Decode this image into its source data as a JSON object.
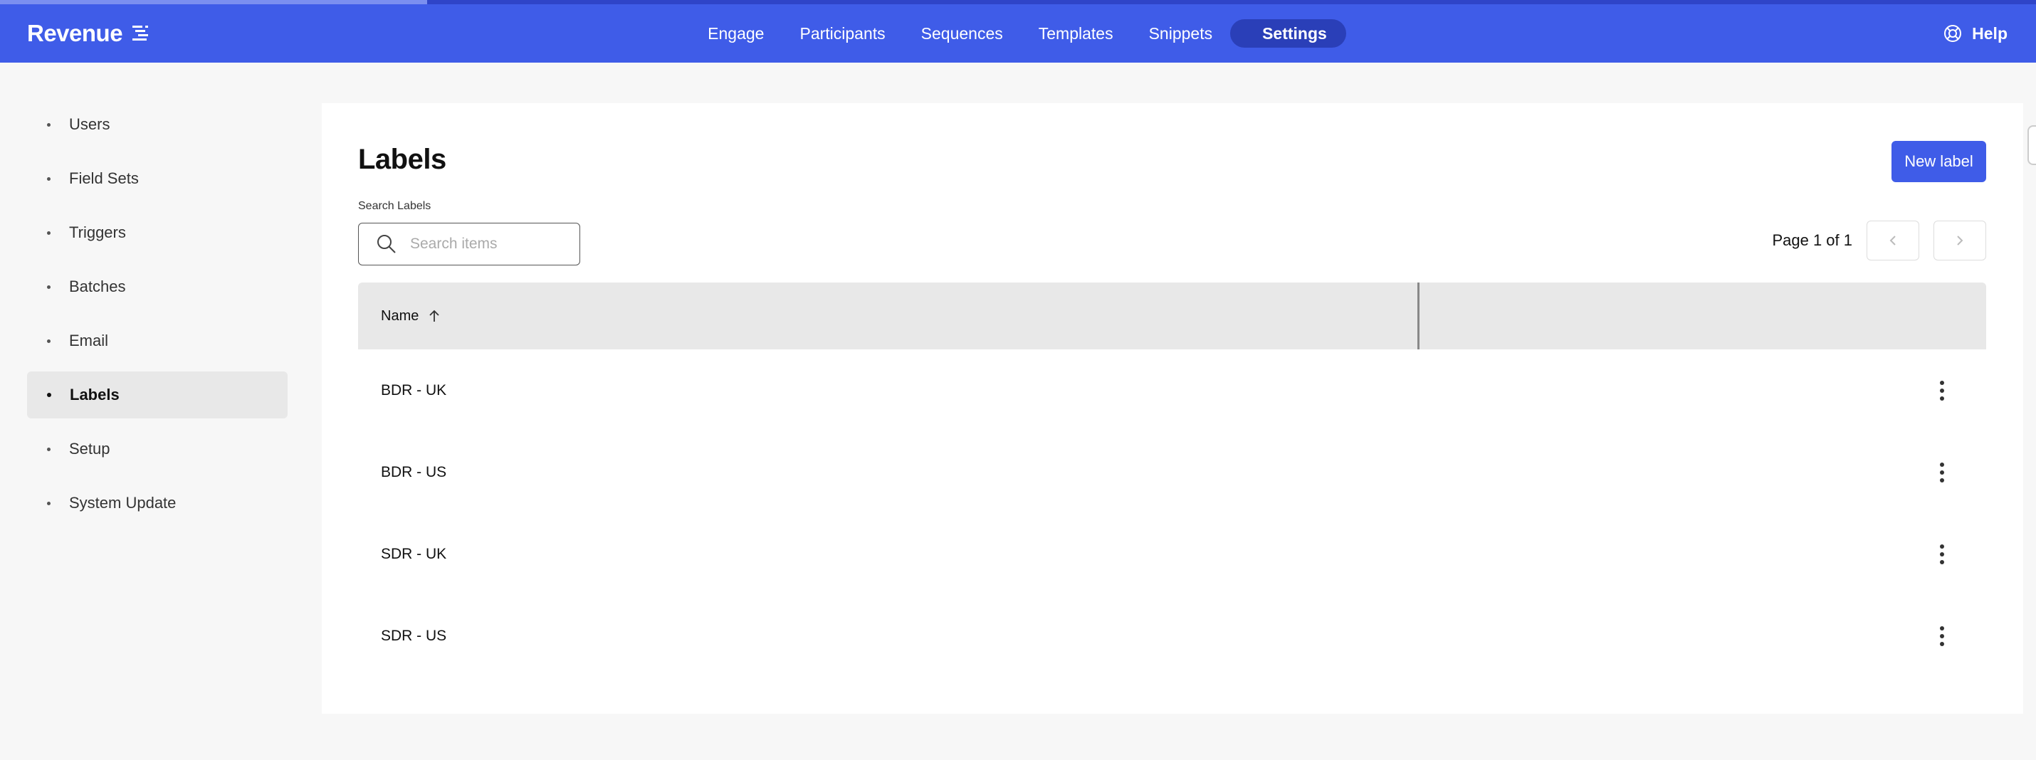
{
  "app": {
    "brand": "Revenue"
  },
  "nav": {
    "tabs": [
      {
        "label": "Engage",
        "active": false
      },
      {
        "label": "Participants",
        "active": false
      },
      {
        "label": "Sequences",
        "active": false
      },
      {
        "label": "Templates",
        "active": false
      },
      {
        "label": "Snippets",
        "active": false
      },
      {
        "label": "Settings",
        "active": true
      }
    ],
    "help": "Help"
  },
  "sidebar": {
    "items": [
      {
        "label": "Users"
      },
      {
        "label": "Field Sets"
      },
      {
        "label": "Triggers"
      },
      {
        "label": "Batches"
      },
      {
        "label": "Email"
      },
      {
        "label": "Labels",
        "active": true
      },
      {
        "label": "Setup"
      },
      {
        "label": "System Update"
      }
    ]
  },
  "main": {
    "title": "Labels",
    "new_button": "New label",
    "search": {
      "label": "Search Labels",
      "placeholder": "Search items",
      "value": ""
    },
    "pager": {
      "text": "Page 1 of 1"
    },
    "table": {
      "columns": [
        {
          "label": "Name",
          "sort": "ascending"
        },
        {
          "label": ""
        }
      ],
      "rows": [
        {
          "name": "BDR - UK"
        },
        {
          "name": "BDR - US"
        },
        {
          "name": "SDR - UK"
        },
        {
          "name": "SDR - US"
        }
      ]
    }
  },
  "colors": {
    "brand": "#3f5ce8",
    "brand_dark": "#2a3fb8",
    "header_bg": "#e8e8e8"
  },
  "icons": [
    "brand-logo-icon",
    "help-icon",
    "search-icon",
    "sort-arrow-up-icon",
    "chevron-left-icon",
    "chevron-right-icon",
    "more-vertical-icon"
  ]
}
